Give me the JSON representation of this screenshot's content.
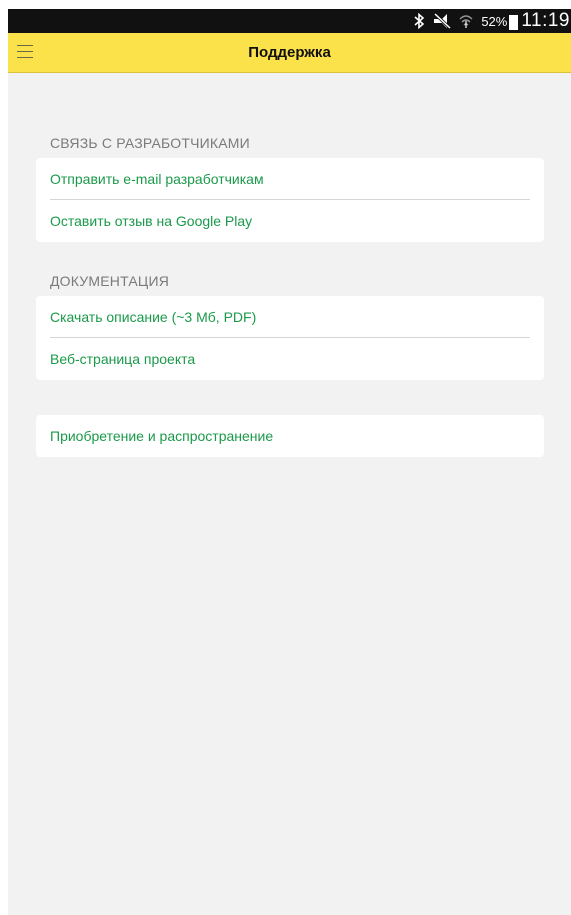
{
  "status_bar": {
    "icons": [
      "bluetooth-icon",
      "vibrate-silent-icon",
      "wifi-icon"
    ],
    "battery": "52%",
    "time": "11:19"
  },
  "app_bar": {
    "title": "Поддержка",
    "menu_icon": "hamburger-menu-icon"
  },
  "sections": [
    {
      "header": "СВЯЗЬ С РАЗРАБОТЧИКАМИ",
      "items": [
        "Отправить e-mail разработчикам",
        "Оставить отзыв на Google Play"
      ]
    },
    {
      "header": "ДОКУМЕНТАЦИЯ",
      "items": [
        "Скачать описание (~3 Мб, PDF)",
        "Веб-страница проекта"
      ]
    },
    {
      "header": "",
      "items": [
        "Приобретение и распространение"
      ]
    }
  ],
  "colors": {
    "accent_bar": "#fbe24a",
    "link_green": "#1a9a4a",
    "background": "#f2f2f2"
  }
}
